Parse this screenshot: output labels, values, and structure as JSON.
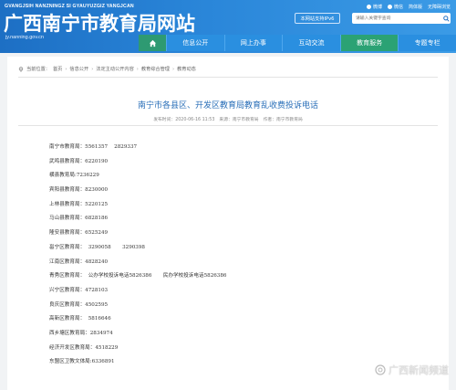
{
  "header": {
    "pinyin": "GVANGJSIH NANZNINGZ SI GYAUYUZGIZ YANGJCAN",
    "title": "广西南宁市教育局网站",
    "domain": "jy.nanning.gov.cn",
    "top_links": [
      "微博",
      "微信",
      "简体版",
      "无障碍浏览"
    ],
    "ipv6_label": "本网站支持IPv6",
    "search_placeholder": "请输入关键字查询"
  },
  "nav": {
    "items": [
      "信息公开",
      "网上办事",
      "互动交流",
      "教育服务",
      "专题专栏"
    ],
    "active": "教育服务"
  },
  "breadcrumb": {
    "label": "当前位置：",
    "items": [
      "首页",
      "信息公开",
      "法定主动公开内容",
      "教育综合管理",
      "教育动态"
    ]
  },
  "article": {
    "title": "南宁市各县区、开发区教育局教育乱收费投诉电话",
    "publish_time": "发布时间：2020-06-16 11:53",
    "source": "来源：南宁市教育局",
    "author": "作者：南宁市教育局",
    "lines": [
      "南宁市教育局：5561357    2829337",
      "武鸣县教育局：6220190",
      "横县教育局:7236229",
      "宾阳县教育局：8230000",
      "上林县教育局：5220125",
      "马山县教育局：6828186",
      "隆安县教育局：6525249",
      "邕宁区教育局：  3290058       3290398",
      "江南区教育局：4828240",
      "青秀区教育局：  公办学校投诉电话5826386       民办学校投诉电话5826386",
      "兴宁区教育局：4728103",
      "良庆区教育局：4502595",
      "高新区教育局：  5816646",
      "西乡塘区教育局：2834974",
      "经济开发区教育局：4518229",
      "东盟区卫教文体局:6336891"
    ]
  },
  "watermark": "广西新闻频道",
  "colors": {
    "header": "#2a86d9",
    "nav_active": "#2ba274",
    "title": "#2a6fb8"
  }
}
